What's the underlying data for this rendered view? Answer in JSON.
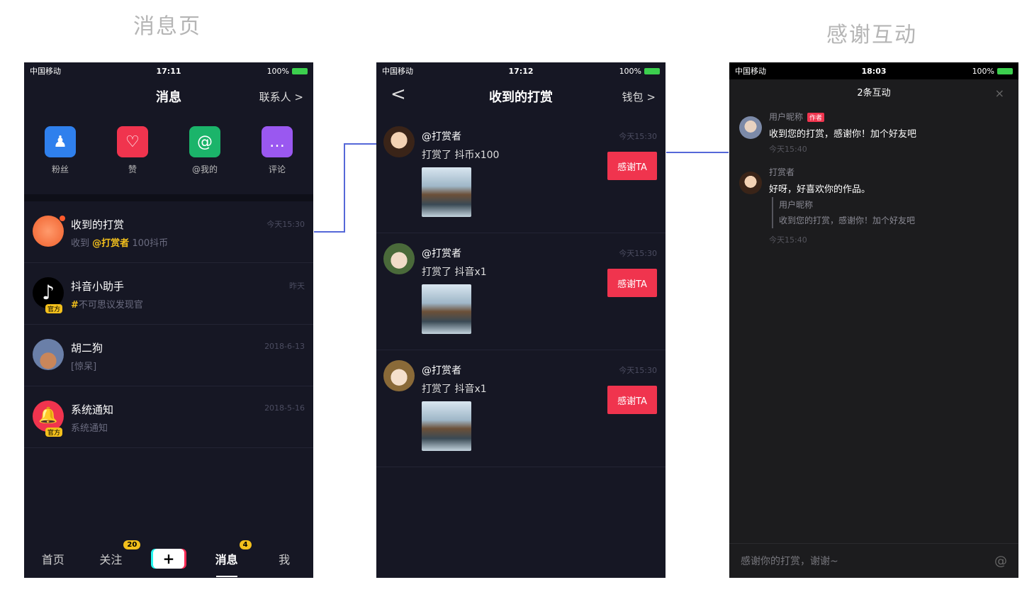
{
  "labels": {
    "left": "消息页",
    "right": "感谢互动"
  },
  "phone1": {
    "status": {
      "carrier": "中国移动",
      "time": "17:11",
      "battery": "100%"
    },
    "nav": {
      "title": "消息",
      "right": "联系人 >"
    },
    "quick": [
      {
        "label": "粉丝",
        "icon": "fans-icon",
        "color": "#2f80ed"
      },
      {
        "label": "赞",
        "icon": "heart-icon",
        "color": "#f0344e"
      },
      {
        "label": "@我的",
        "icon": "at-icon",
        "color": "#1bb46a"
      },
      {
        "label": "评论",
        "icon": "comment-icon",
        "color": "#9a58f0"
      }
    ],
    "rows": [
      {
        "name": "收到的打赏",
        "sub_prefix": "收到",
        "sub_user": "@打赏者",
        "sub_suffix": "100抖币",
        "time": "今天15:30"
      },
      {
        "name": "抖音小助手",
        "sub_hash": "#",
        "sub": "不可思议发现官",
        "time": "昨天",
        "badge": "官方"
      },
      {
        "name": "胡二狗",
        "sub": "[惊呆]",
        "time": "2018-6-13"
      },
      {
        "name": "系统通知",
        "sub": "系统通知",
        "time": "2018-5-16",
        "badge": "官方"
      }
    ],
    "tabs": [
      {
        "label": "首页"
      },
      {
        "label": "关注",
        "badge": "20"
      },
      {
        "label": "+"
      },
      {
        "label": "消息",
        "badge": "4"
      },
      {
        "label": "我"
      }
    ]
  },
  "phone2": {
    "status": {
      "carrier": "中国移动",
      "time": "17:12",
      "battery": "100%"
    },
    "nav": {
      "back": "<",
      "title": "收到的打赏",
      "right": "钱包 >"
    },
    "gifts": [
      {
        "user": "@打赏者",
        "text": "打赏了 抖币x100",
        "time": "今天15:30",
        "button": "感谢TA"
      },
      {
        "user": "@打赏者",
        "text": "打赏了 抖音x1",
        "time": "今天15:30",
        "button": "感谢TA"
      },
      {
        "user": "@打赏者",
        "text": "打赏了 抖音x1",
        "time": "今天15:30",
        "button": "感谢TA"
      }
    ]
  },
  "phone3": {
    "status": {
      "carrier": "中国移动",
      "time": "18:03",
      "battery": "100%"
    },
    "header": {
      "title": "2条互动",
      "close": "×"
    },
    "comments": [
      {
        "name": "用户昵称",
        "tag": "作者",
        "text": "收到您的打赏，感谢你！加个好友吧",
        "time": "今天15:40"
      },
      {
        "name": "打赏者",
        "text": "好呀，好喜欢你的作品。",
        "quote_name": "用户昵称",
        "quote_text": "收到您的打赏，感谢你！加个好友吧",
        "time": "今天15:40"
      }
    ],
    "input": {
      "placeholder": "感谢你的打赏，谢谢~",
      "icon": "at-icon"
    }
  }
}
